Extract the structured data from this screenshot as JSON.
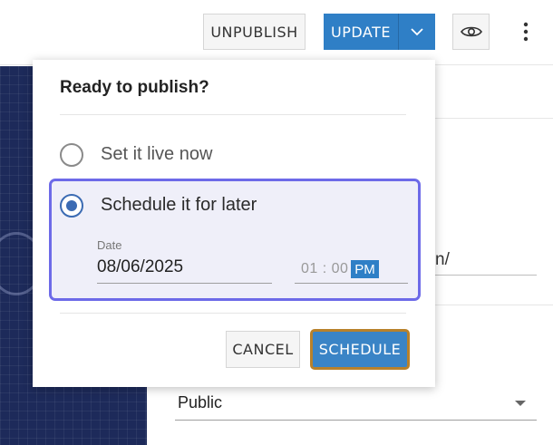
{
  "toolbar": {
    "unpublish_label": "UNPUBLISH",
    "update_label": "UPDATE",
    "update_menu_icon": "chevron-down-icon",
    "preview_icon": "eye-icon",
    "more_icon": "vertical-dots-icon"
  },
  "background": {
    "url_value": "n/",
    "visibility_value": "Public"
  },
  "publish_popover": {
    "title": "Ready to publish?",
    "options": [
      {
        "label": "Set it live now",
        "selected": false
      },
      {
        "label": "Schedule it for later",
        "selected": true
      }
    ],
    "schedule": {
      "date_label": "Date",
      "date_value": "08/06/2025",
      "time_value": "01 : 00",
      "ampm": "PM"
    },
    "cancel_label": "CANCEL",
    "schedule_label": "SCHEDULE"
  },
  "colors": {
    "primary": "#2f7fc6",
    "highlight_border": "#6d6ae8",
    "highlight_bg": "#efeff9",
    "focus_ring": "#b8812b"
  }
}
